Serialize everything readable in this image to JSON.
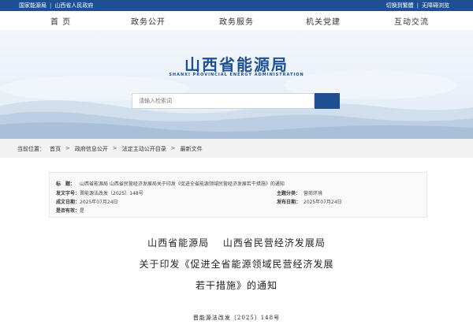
{
  "topbar": {
    "links_left": [
      "国家能源局",
      "|",
      "山西省人民政府"
    ],
    "links_right": [
      "切换到繁體",
      "|",
      "无障碍浏览"
    ]
  },
  "nav": {
    "items": [
      "首 页",
      "政务公开",
      "政务服务",
      "机关党建",
      "互动交流"
    ]
  },
  "banner": {
    "title": "山西省能源局",
    "subtitle": "SHANXI PROVINCIAL ENERGY ADMINISTRATION"
  },
  "search": {
    "placeholder": "请输入检索词"
  },
  "breadcrumb": {
    "label": "当前位置：",
    "items": [
      "首页",
      "政府信息公开",
      "法定主动公开目录",
      "最新文件"
    ]
  },
  "info": {
    "title_key": "标　题：",
    "title_value": "山西省能源局 山西省民营经济发展局关于印发《促进全省能源领域民营经济发展若干措施》的通知",
    "doc_no_key": "发文字号：",
    "doc_no_value": "晋能源法改发〔2025〕148号",
    "topic_key": "主题分类：",
    "topic_value": "营商环境",
    "created_key": "成文日期：",
    "created_value": "2025年07月24日",
    "published_key": "发布日期：",
    "published_value": "2025年07月24日",
    "valid_key": "是否有效：",
    "valid_value": "是"
  },
  "document": {
    "line1": "山西省能源局　 山西省民营经济发展局",
    "line2": "关于印发《促进全省能源领域民营经济发展",
    "line3": "若干措施》的通知",
    "number": "晋能源法改发〔2025〕148号"
  },
  "colors": {
    "brand": "#1f4f93",
    "crumb_bg": "#f2f2f2"
  }
}
